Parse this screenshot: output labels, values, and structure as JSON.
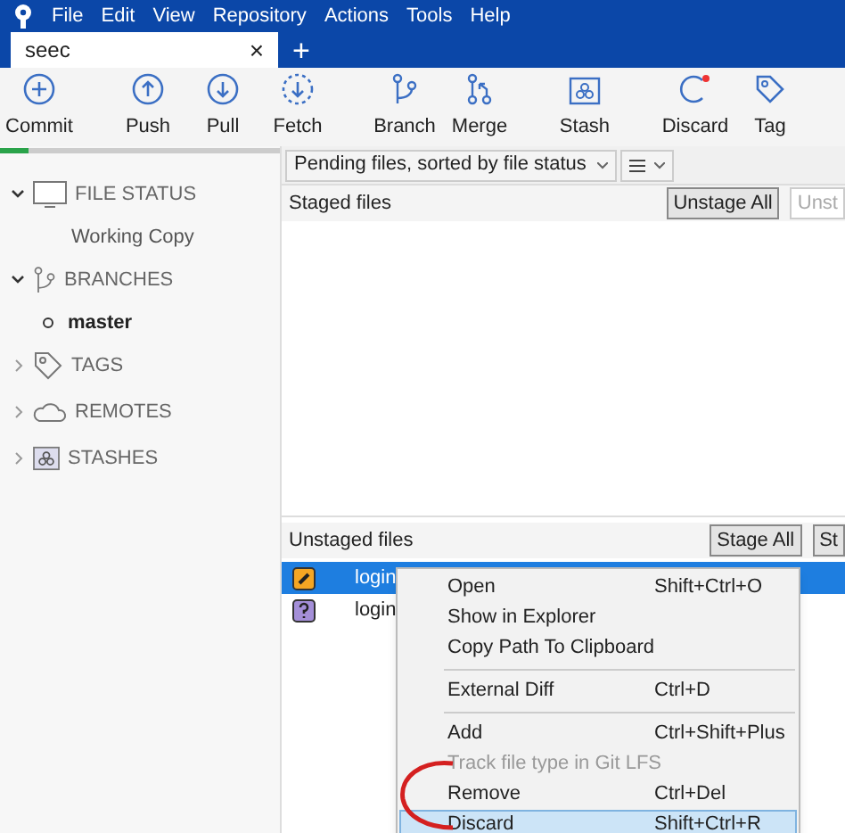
{
  "menu_bar": [
    "File",
    "Edit",
    "View",
    "Repository",
    "Actions",
    "Tools",
    "Help"
  ],
  "tabs": [
    {
      "label": "seec",
      "selected": true,
      "close": "×"
    }
  ],
  "new_tab": "+",
  "toolbar": [
    {
      "label": "Commit",
      "kind": "plus"
    },
    {
      "label": "Push",
      "kind": "up"
    },
    {
      "label": "Pull",
      "kind": "down"
    },
    {
      "label": "Fetch",
      "kind": "fetch"
    },
    {
      "label": "Branch",
      "kind": "branch"
    },
    {
      "label": "Merge",
      "kind": "merge"
    },
    {
      "label": "Stash",
      "kind": "stash"
    },
    {
      "label": "Discard",
      "kind": "discard"
    },
    {
      "label": "Tag",
      "kind": "tag"
    }
  ],
  "progress": {
    "level": 0.1
  },
  "sidebar": [
    {
      "label": "FILE STATUS",
      "kind": "monitor",
      "expanded": true,
      "children": [
        {
          "label": "Working Copy",
          "kind": "view"
        }
      ]
    },
    {
      "label": "BRANCHES",
      "kind": "branch",
      "expanded": true,
      "children": [
        {
          "label": "master",
          "kind": "branch"
        }
      ]
    },
    {
      "label": "TAGS",
      "kind": "tag",
      "expanded": false
    },
    {
      "label": "REMOTES",
      "kind": "cloud",
      "expanded": false
    },
    {
      "label": "STASHES",
      "kind": "stash",
      "expanded": false
    }
  ],
  "filter": {
    "value": "Pending files, sorted by file status"
  },
  "staged": {
    "title": "Staged files",
    "buttons": [
      {
        "label": "Unstage All",
        "disabled": false
      },
      {
        "label": "Unst",
        "disabled": true
      }
    ]
  },
  "unstaged": {
    "title": "Unstaged files",
    "buttons": [
      {
        "label": "Stage All",
        "disabled": false
      },
      {
        "label": "St",
        "disabled": false
      }
    ],
    "files": [
      {
        "name": "login",
        "kind": "modified",
        "selected": true
      },
      {
        "name": "login",
        "kind": "untracked",
        "selected": false
      }
    ]
  },
  "context_menu": [
    {
      "kind": "item",
      "label": "Open",
      "shortcut": "Shift+Ctrl+O",
      "disabled": false,
      "selected": false
    },
    {
      "kind": "item",
      "label": "Show in Explorer",
      "disabled": false,
      "selected": false
    },
    {
      "kind": "item",
      "label": "Copy Path To Clipboard",
      "disabled": false,
      "selected": false
    },
    {
      "kind": "separator"
    },
    {
      "kind": "item",
      "label": "External Diff",
      "shortcut": "Ctrl+D",
      "disabled": false,
      "selected": false
    },
    {
      "kind": "separator"
    },
    {
      "kind": "item",
      "label": "Add",
      "shortcut": "Ctrl+Shift+Plus",
      "disabled": false,
      "selected": false
    },
    {
      "kind": "item",
      "label": "Track file type in Git LFS",
      "disabled": true,
      "selected": false
    },
    {
      "kind": "item",
      "label": "Remove",
      "shortcut": "Ctrl+Del",
      "disabled": false,
      "selected": false
    },
    {
      "kind": "item",
      "label": "Discard",
      "shortcut": "Shift+Ctrl+R",
      "disabled": false,
      "selected": true
    }
  ]
}
